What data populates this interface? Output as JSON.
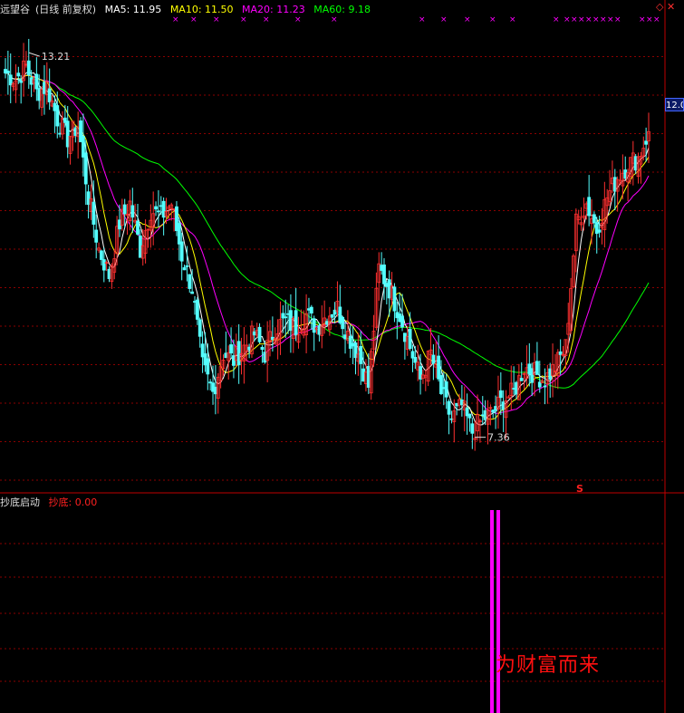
{
  "header": {
    "name": "远望谷",
    "mode": "(日线 前复权)",
    "ma": [
      {
        "label": "MA5: 11.95",
        "color": "#ffffff"
      },
      {
        "label": "MA10: 11.50",
        "color": "#ffff00"
      },
      {
        "label": "MA20: 11.23",
        "color": "#ff00ff"
      },
      {
        "label": "MA60: 9.18",
        "color": "#00ff00"
      }
    ]
  },
  "indicator": {
    "name": "抄底启动",
    "value_label": "抄底: 0.00",
    "value_color": "#ff2020"
  },
  "annotations": {
    "high_label": "13.21",
    "low_label": "7.36",
    "signal_mark": "S",
    "current_price": "12.0"
  },
  "slogan": "为财富而来",
  "colors": {
    "up": "#ff3030",
    "down": "#54ffff",
    "ma5": "#ffffff",
    "ma10": "#ffff00",
    "ma20": "#ff00ff",
    "ma60": "#00ff00",
    "grid": "#8b0000",
    "signal": "#ff00ff"
  },
  "chart_data": {
    "type": "candlestick",
    "price_range": [
      6.8,
      13.6
    ],
    "high_close": 13.21,
    "low_close": 7.36,
    "anchor_closes": [
      12.9,
      12.8,
      13.0,
      12.6,
      12.7,
      12.2,
      11.9,
      12.1,
      11.0,
      10.2,
      9.8,
      10.6,
      10.9,
      10.2,
      10.8,
      10.7,
      10.9,
      10.1,
      9.6,
      8.4,
      8.0,
      8.6,
      8.5,
      8.7,
      8.9,
      8.6,
      9.0,
      9.1,
      9.0,
      9.2,
      9.0,
      9.2,
      9.3,
      8.9,
      8.6,
      8.1,
      9.9,
      9.6,
      9.2,
      8.7,
      8.2,
      8.6,
      8.0,
      7.6,
      7.8,
      7.4,
      7.6,
      7.7,
      7.9,
      8.0,
      8.4,
      8.3,
      8.2,
      8.4,
      8.7,
      10.6,
      10.9,
      10.5,
      11.0,
      11.3,
      11.5,
      11.6,
      12.0
    ],
    "indicator_signals": [
      549
    ]
  }
}
